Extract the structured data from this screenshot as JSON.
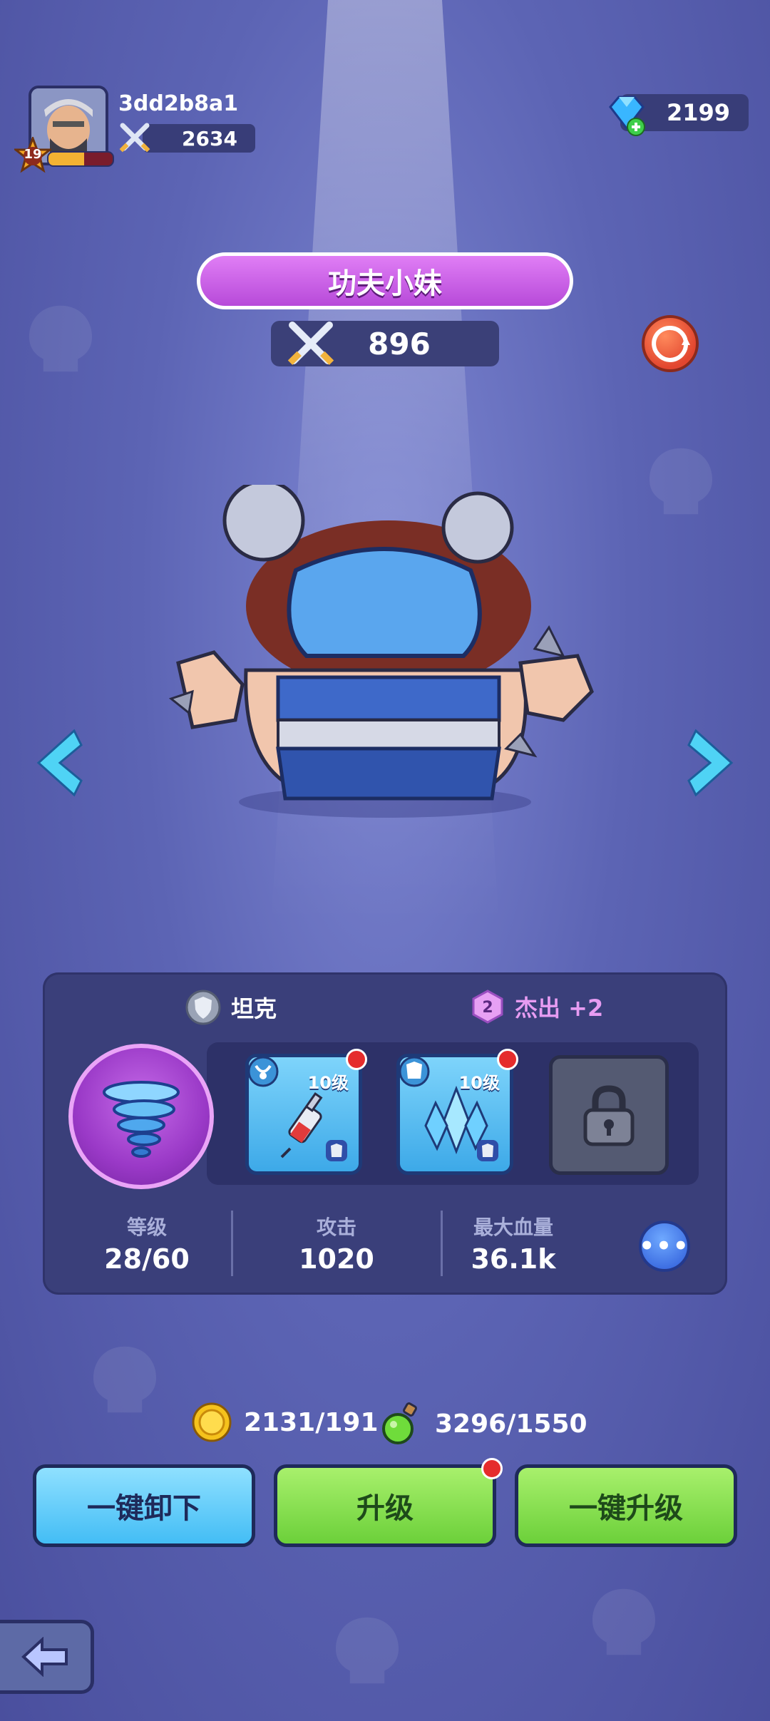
{
  "player": {
    "username": "3dd2b8a1",
    "level": "19",
    "xp_fraction": 0.55,
    "power": "2634"
  },
  "currency": {
    "gems": "2199"
  },
  "hero": {
    "name": "功夫小妹",
    "power": "896"
  },
  "panel": {
    "role": "坦克",
    "rarity_level": "2",
    "rarity_label": "杰出 +2",
    "equipment": [
      {
        "level": "10级"
      },
      {
        "level": "10级"
      }
    ],
    "stats": [
      {
        "label": "等级",
        "value": "28/60"
      },
      {
        "label": "攻击",
        "value": "1020"
      },
      {
        "label": "最大血量",
        "value": "36.1k"
      }
    ],
    "more_label": "•••"
  },
  "resources": {
    "coins": "2131/191",
    "potions": "3296/1550"
  },
  "buttons": {
    "unequip_all": "一键卸下",
    "upgrade": "升级",
    "upgrade_all": "一键升级"
  },
  "colors": {
    "background": "#5c64b4",
    "hero_banner": "#c85ae6",
    "button_blue": "#43bdf5",
    "button_green": "#6cd03a",
    "notification": "#e52c2c"
  }
}
